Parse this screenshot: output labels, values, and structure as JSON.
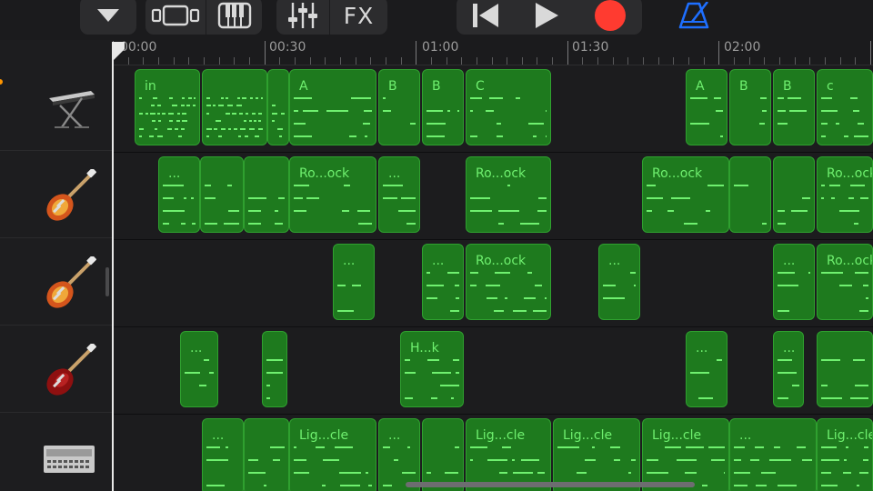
{
  "toolbar": {
    "fx_label": "FX",
    "record_color": "#ff3b30",
    "metronome_color": "#1e6fff",
    "icons": [
      "dropdown-icon",
      "tracks-view-icon",
      "keyboard-icon",
      "mixer-icon",
      "go-to-start-icon",
      "play-icon",
      "record-icon",
      "metronome-icon"
    ]
  },
  "ruler": {
    "labels": [
      "00:00",
      "00:30",
      "01:00",
      "01:30",
      "02:00"
    ]
  },
  "tracks": [
    {
      "instrument": "keyboard-icon",
      "regions": [
        {
          "label": "in"
        },
        {
          "label": ""
        },
        {
          "label": ""
        },
        {
          "label": "A"
        },
        {
          "label": "B"
        },
        {
          "label": "B"
        },
        {
          "label": "C"
        },
        {
          "label": "A"
        },
        {
          "label": "B"
        },
        {
          "label": "B"
        },
        {
          "label": "c"
        }
      ]
    },
    {
      "instrument": "electric-guitar-sunburst-icon",
      "regions": [
        {
          "label": "..."
        },
        {
          "label": ""
        },
        {
          "label": ""
        },
        {
          "label": "Ro...ock"
        },
        {
          "label": "..."
        },
        {
          "label": "Ro...ock"
        },
        {
          "label": "Ro...ock"
        },
        {
          "label": ""
        },
        {
          "label": ""
        },
        {
          "label": "Ro...ock"
        }
      ]
    },
    {
      "instrument": "electric-guitar-sunburst-icon",
      "regions": [
        {
          "label": "..."
        },
        {
          "label": "..."
        },
        {
          "label": "Ro...ock"
        },
        {
          "label": "..."
        },
        {
          "label": "..."
        },
        {
          "label": "Ro...ock"
        }
      ]
    },
    {
      "instrument": "electric-guitar-red-icon",
      "regions": [
        {
          "label": "..."
        },
        {
          "label": ""
        },
        {
          "label": "H...k"
        },
        {
          "label": "..."
        },
        {
          "label": "..."
        },
        {
          "label": ""
        }
      ]
    },
    {
      "instrument": "drum-machine-icon",
      "regions": [
        {
          "label": "..."
        },
        {
          "label": ""
        },
        {
          "label": "Lig...cle"
        },
        {
          "label": "..."
        },
        {
          "label": ""
        },
        {
          "label": "Lig...cle"
        },
        {
          "label": "Lig...cle"
        },
        {
          "label": "Lig...cle"
        },
        {
          "label": "..."
        },
        {
          "label": "Lig...cle"
        }
      ]
    }
  ]
}
